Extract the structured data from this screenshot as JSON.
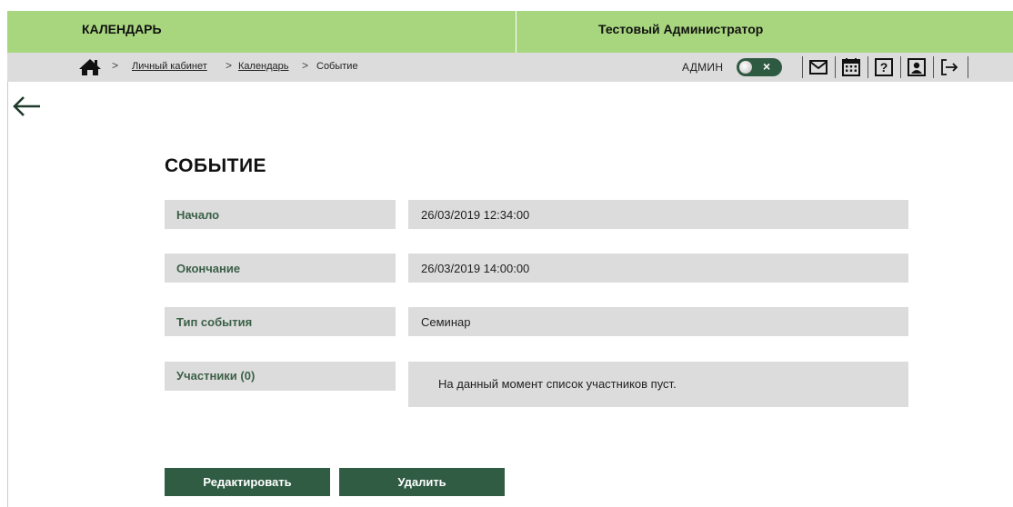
{
  "header": {
    "app_title": "КАЛЕНДАРЬ",
    "user_name": "Тестовый Администратор",
    "color": "#a8d67e"
  },
  "navbar": {
    "breadcrumb": {
      "home_icon": "home-icon",
      "items": [
        {
          "label": "Личный кабинет",
          "link": true
        },
        {
          "label": "Календарь",
          "link": true
        },
        {
          "label": "Событие",
          "link": false
        }
      ],
      "separator": ">"
    },
    "admin_label": "АДМИН",
    "admin_toggle": {
      "state": "off",
      "symbol": "×"
    },
    "icons": [
      "mail-icon",
      "calendar-icon",
      "help-icon",
      "profile-icon",
      "logout-icon"
    ]
  },
  "page": {
    "back_icon": "back-arrow-icon",
    "title": "СОБЫТИЕ",
    "fields": [
      {
        "label": "Начало",
        "value": "26/03/2019 12:34:00"
      },
      {
        "label": "Окончание",
        "value": "26/03/2019 14:00:00"
      },
      {
        "label": "Тип события",
        "value": "Семинар"
      },
      {
        "label": "Участники (0)",
        "value": "На данный момент список участников пуст."
      }
    ],
    "buttons": {
      "edit": "Редактировать",
      "delete": "Удалить"
    },
    "button_color": "#305c44",
    "label_color": "#3b6048"
  }
}
